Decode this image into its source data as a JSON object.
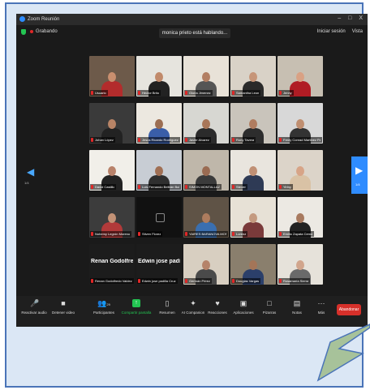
{
  "window": {
    "title": "Zoom Reunión",
    "controls": [
      "–",
      "□",
      "X"
    ]
  },
  "topbar": {
    "recording_label": "Grabando",
    "speaking_banner": "monica prieto está hablando...",
    "right_items": [
      "Iniciar sesión",
      "Vista"
    ]
  },
  "nav": {
    "left_arrow": "◀",
    "left_page": "1/4",
    "right_arrow": "▶",
    "right_page": "1/4"
  },
  "tiles": [
    {
      "name": "Usuario"
    },
    {
      "name": "Hector Brito"
    },
    {
      "name": "Gloria Jimenez"
    },
    {
      "name": "Samantha Leon"
    },
    {
      "name": "Jenny"
    },
    {
      "name": "Johan López"
    },
    {
      "name": "Jesus Ricardo Rodriguez"
    },
    {
      "name": "Javier Alvarez"
    },
    {
      "name": "Rony Tavera"
    },
    {
      "name": "Fredy Conrad Martinez Padr..."
    },
    {
      "name": "David Castillo"
    },
    {
      "name": "Luis Fernando Beltrán Bula"
    },
    {
      "name": "SIMON MONTALLAZ"
    },
    {
      "name": "Steven"
    },
    {
      "name": "Yiriny"
    },
    {
      "name": "Nohemy Legrón Moreno"
    },
    {
      "name": "Stiven Florez"
    },
    {
      "name": "YAIRES BARANOVA MON..."
    },
    {
      "name": "Lorena"
    },
    {
      "name": "Emilio Zapata Cerna"
    },
    {
      "name": "Renan Godolfredo Valdez",
      "big": "Renan Godolfre..."
    },
    {
      "name": "Edwin jose padilla Cruz",
      "big": "Edwin jose padi..."
    },
    {
      "name": "Germán Pérez"
    },
    {
      "name": "Douglas Vargas"
    },
    {
      "name": "Rosamaría Sierra"
    }
  ],
  "toolbar": {
    "audio": "Reactivar audio",
    "video": "Detener video",
    "participants": "Participantes",
    "participants_count": "29",
    "share": "Compartir pantalla",
    "summary": "Resumen",
    "companion": "AI Companion",
    "reactions": "Reacciones",
    "apps": "Aplicaciones",
    "whiteboards": "Pizarras",
    "notes": "Notas",
    "more": "Más",
    "leave": "Abandonar"
  },
  "icons": {
    "audio": "microphone-off-icon",
    "video": "camera-icon",
    "participants": "people-icon",
    "share": "share-screen-icon",
    "summary": "document-icon",
    "companion": "sparkle-icon",
    "reactions": "heart-icon",
    "apps": "apps-icon",
    "whiteboards": "whiteboard-icon",
    "notes": "notes-icon",
    "more": "ellipsis-icon"
  },
  "colors": {
    "accent": "#2d8cff",
    "share_green": "#23c552",
    "leave_red": "#d6302a",
    "frame_border": "#4a74b8",
    "frame_fill": "#dbe7f5",
    "arrow_fill": "#a7c29a"
  }
}
